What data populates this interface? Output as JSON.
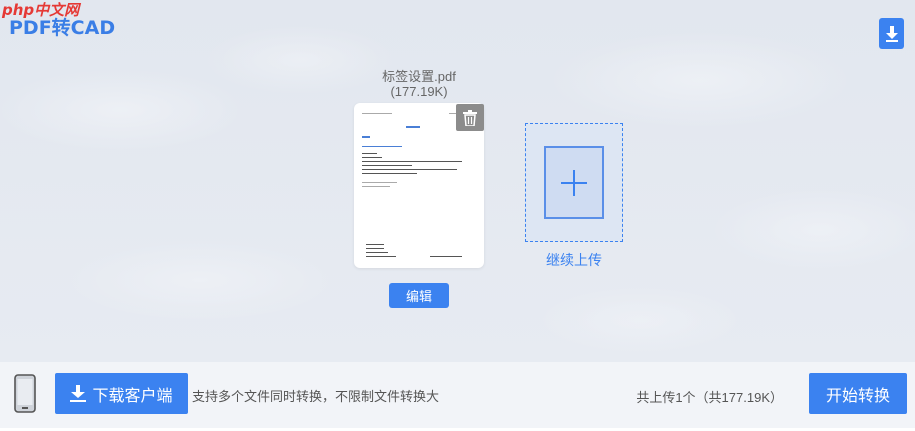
{
  "watermark": "php中文网",
  "app": {
    "title": "PDF转CAD"
  },
  "icons": {
    "corner_download": "download-icon",
    "delete": "trash-icon",
    "add": "plus-icon",
    "phone": "phone-icon",
    "client_download": "download-icon"
  },
  "file": {
    "name": "标签设置.pdf",
    "size": "(177.19K)",
    "edit_label": "编辑"
  },
  "upload": {
    "continue_label": "继续上传"
  },
  "bottom": {
    "download_client_label": "下载客户端",
    "support_text": "支持多个文件同时转换，不限制文件转换大",
    "summary": "共上传1个（共177.19K）",
    "start_label": "开始转换"
  },
  "colors": {
    "accent": "#3b82f0",
    "title": "#3a7ee6",
    "watermark": "#e53935",
    "delete_bg": "#8c8c8c"
  }
}
